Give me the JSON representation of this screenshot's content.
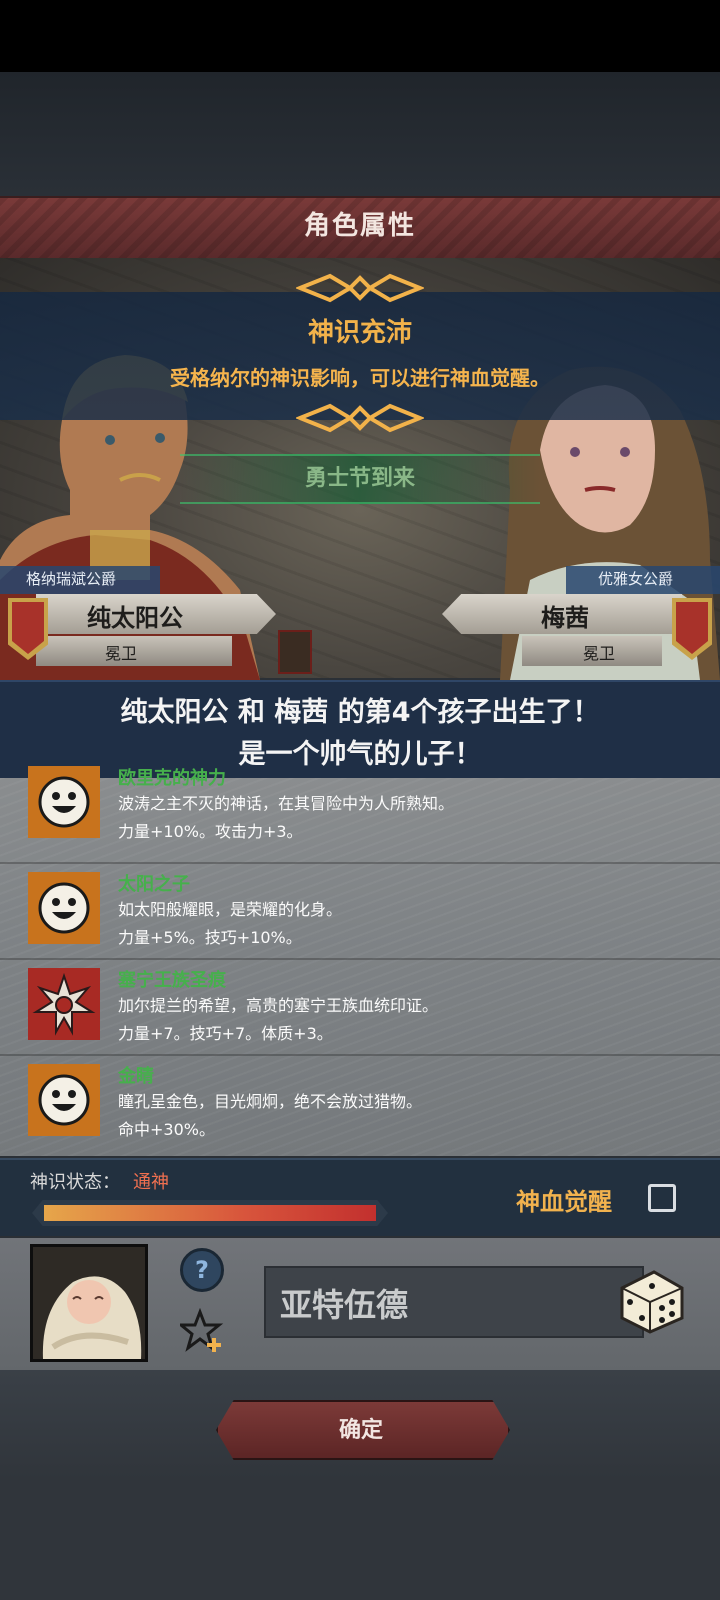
{
  "header": {
    "title": "角色属性"
  },
  "notice": {
    "title": "神识充沛",
    "text": "受格纳尔的神识影响，可以进行神血觉醒。"
  },
  "background": {
    "festival_banner": "勇士节到来"
  },
  "father": {
    "rank": "格纳瑞斌公爵",
    "name": "纯太阳公",
    "role": "冕卫"
  },
  "mother": {
    "rank": "优雅女公爵",
    "name": "梅茜",
    "role": "冕卫"
  },
  "birth_message": {
    "line1": "纯太阳公 和 梅茜 的第4个孩子出生了！",
    "line2": "是一个帅气的儿子！"
  },
  "traits": [
    {
      "name": "欧里克的神力",
      "desc": "波涛之主不灭的神话，在其冒险中为人所熟知。",
      "effect": "力量+10%。攻击力+3。",
      "icon": "smiley-icon"
    },
    {
      "name": "太阳之子",
      "desc": "如太阳般耀眼，是荣耀的化身。",
      "effect": "力量+5%。技巧+10%。",
      "icon": "smiley-icon"
    },
    {
      "name": "塞宁王族圣痕",
      "desc": "加尔提兰的希望，高贵的塞宁王族血统印证。",
      "effect": "力量+7。技巧+7。体质+3。",
      "icon": "sun-crest-icon"
    },
    {
      "name": "金睛",
      "desc": "瞳孔呈金色，目光炯炯，绝不会放过猎物。",
      "effect": "命中+30%。",
      "icon": "smiley-icon"
    }
  ],
  "spirit": {
    "label": "神识状态：",
    "value": "通神",
    "progress": 1.0,
    "awaken_label": "神血觉醒",
    "awaken_checked": false
  },
  "child": {
    "name": "亚特伍德"
  },
  "actions": {
    "confirm": "确定"
  },
  "colors": {
    "accent_gold": "#f1b24e",
    "trait_green": "#46b04c",
    "status_red": "#f07050",
    "title_red": "#7a3a39"
  }
}
